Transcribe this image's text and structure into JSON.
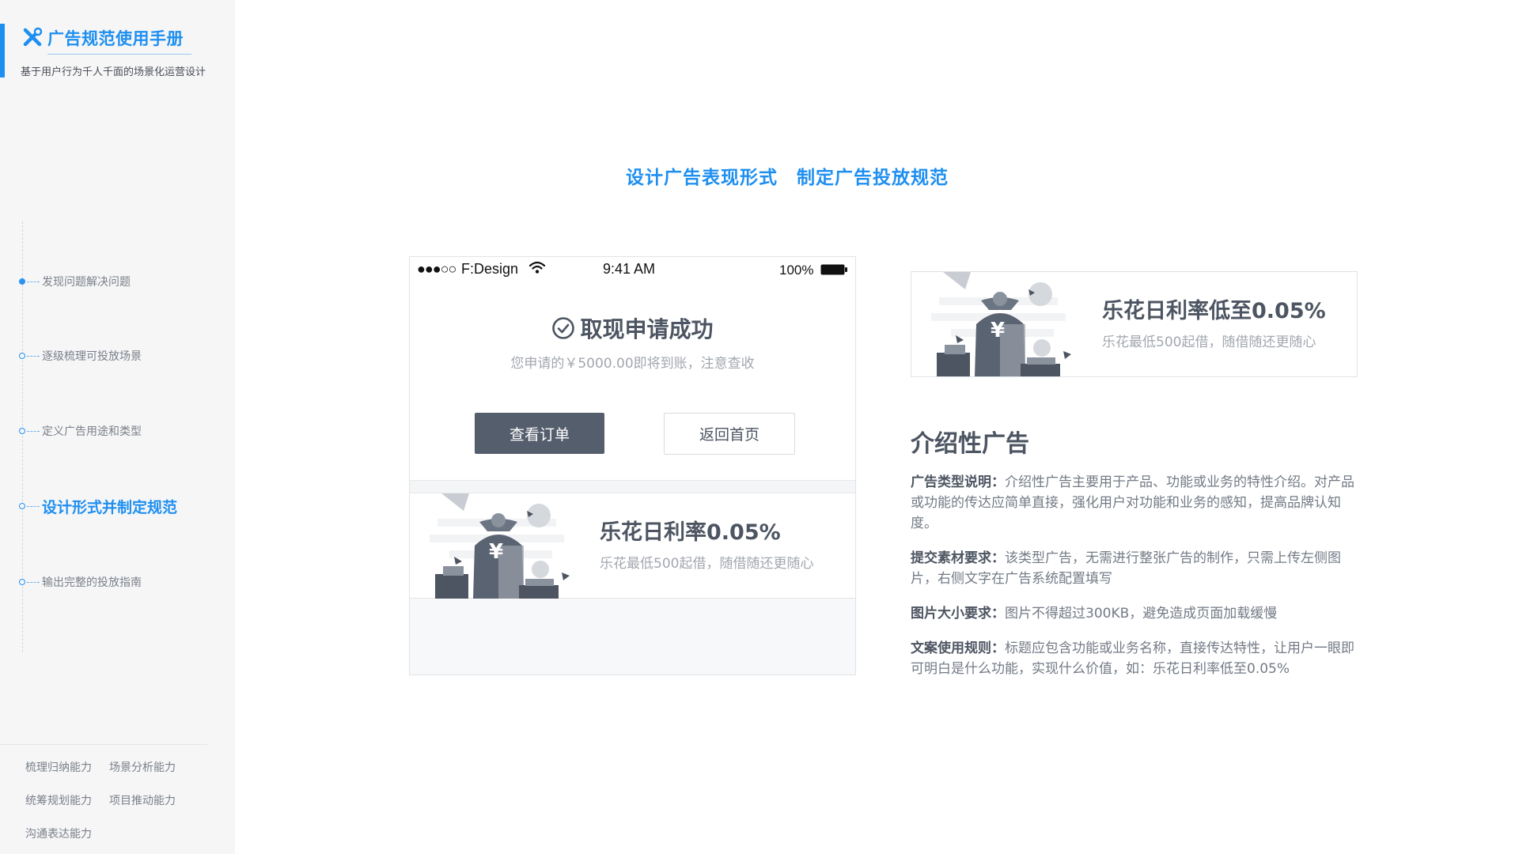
{
  "sidebar": {
    "title": "广告规范使用手册",
    "subtitle": "基于用户行为千人千面的场景化运营设计",
    "nav": [
      {
        "label": "发现问题解决问题"
      },
      {
        "label": "逐级梳理可投放场景"
      },
      {
        "label": "定义广告用途和类型"
      },
      {
        "label": "设计形式并制定规范"
      },
      {
        "label": "输出完整的投放指南"
      }
    ],
    "skills": [
      "梳理归纳能力",
      "场景分析能力",
      "统筹规划能力",
      "项目推动能力",
      "沟通表达能力"
    ]
  },
  "main": {
    "hero_title": "设计广告表现形式　制定广告投放规范",
    "phone": {
      "status": {
        "signal": "●●●○○",
        "carrier": "F:Design",
        "time": "9:41 AM",
        "battery": "100%"
      },
      "success_title": "取现申请成功",
      "success_desc": "您申请的￥5000.00即将到账，注意查收",
      "btn_primary": "查看订单",
      "btn_secondary": "返回首页",
      "ad": {
        "title": "乐花日利率0.05%",
        "sub": "乐花最低500起借，随借随还更随心"
      }
    },
    "sample_ad": {
      "title": "乐花日利率低至0.05%",
      "sub": "乐花最低500起借，随借随还更随心"
    },
    "desc": {
      "heading": "介绍性广告",
      "items": [
        {
          "label": "广告类型说明：",
          "text": "介绍性广告主要用于产品、功能或业务的特性介绍。对产品或功能的传达应简单直接，强化用户对功能和业务的感知，提高品牌认知度。"
        },
        {
          "label": "提交素材要求：",
          "text": "该类型广告，无需进行整张广告的制作，只需上传左侧图片，右侧文字在广告系统配置填写"
        },
        {
          "label": "图片大小要求：",
          "text": "图片不得超过300KB，避免造成页面加载缓慢"
        },
        {
          "label": "文案使用规则：",
          "text": "标题应包含功能或业务名称，直接传达特性，让用户一眼即可明白是什么功能，实现什么价值，如：乐花日利率低至0.05%"
        }
      ]
    }
  },
  "colors": {
    "accent": "#1e8ff0",
    "sidebar_bg": "#f6f6f7",
    "primary_button": "#555e6c"
  },
  "icons": [
    "tools-icon",
    "wifi-icon",
    "battery-icon",
    "check-circle-icon",
    "money-bag-illustration"
  ]
}
